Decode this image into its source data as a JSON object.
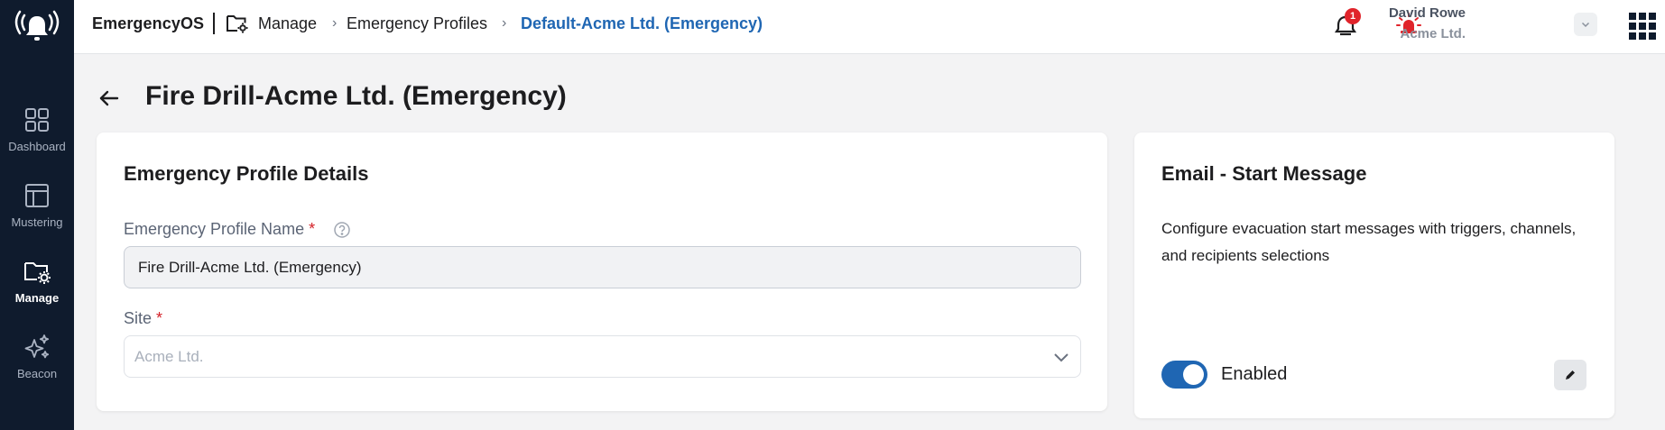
{
  "app": {
    "brand": "EmergencyOS"
  },
  "sidebar": {
    "items": [
      {
        "label": "Dashboard",
        "icon": "dashboard-grid-icon"
      },
      {
        "label": "Mustering",
        "icon": "layout-panel-icon"
      },
      {
        "label": "Manage",
        "icon": "folder-gear-icon",
        "active": true
      },
      {
        "label": "Beacon",
        "icon": "sparkles-icon"
      }
    ]
  },
  "breadcrumb": {
    "items": [
      {
        "label": "Manage"
      },
      {
        "label": "Emergency Profiles"
      },
      {
        "label": "Default-Acme Ltd. (Emergency)"
      }
    ]
  },
  "header": {
    "notifications_count": "1",
    "user_name": "David Rowe",
    "user_org": "Acme Ltd."
  },
  "page": {
    "title": "Fire Drill-Acme Ltd. (Emergency)"
  },
  "details_card": {
    "title": "Emergency Profile Details",
    "name_label": "Emergency Profile Name",
    "name_value": "Fire Drill-Acme Ltd. (Emergency)",
    "site_label": "Site",
    "site_placeholder": "Acme Ltd.",
    "required_mark": "*"
  },
  "email_card": {
    "title": "Email - Start Message",
    "description": "Configure evacuation start messages with triggers, channels, and recipients selections",
    "toggle_label": "Enabled",
    "toggle_on": true
  },
  "colors": {
    "sidebar_bg": "#0f1b2d",
    "accent": "#1f66b3",
    "alert_red": "#e0242b"
  }
}
